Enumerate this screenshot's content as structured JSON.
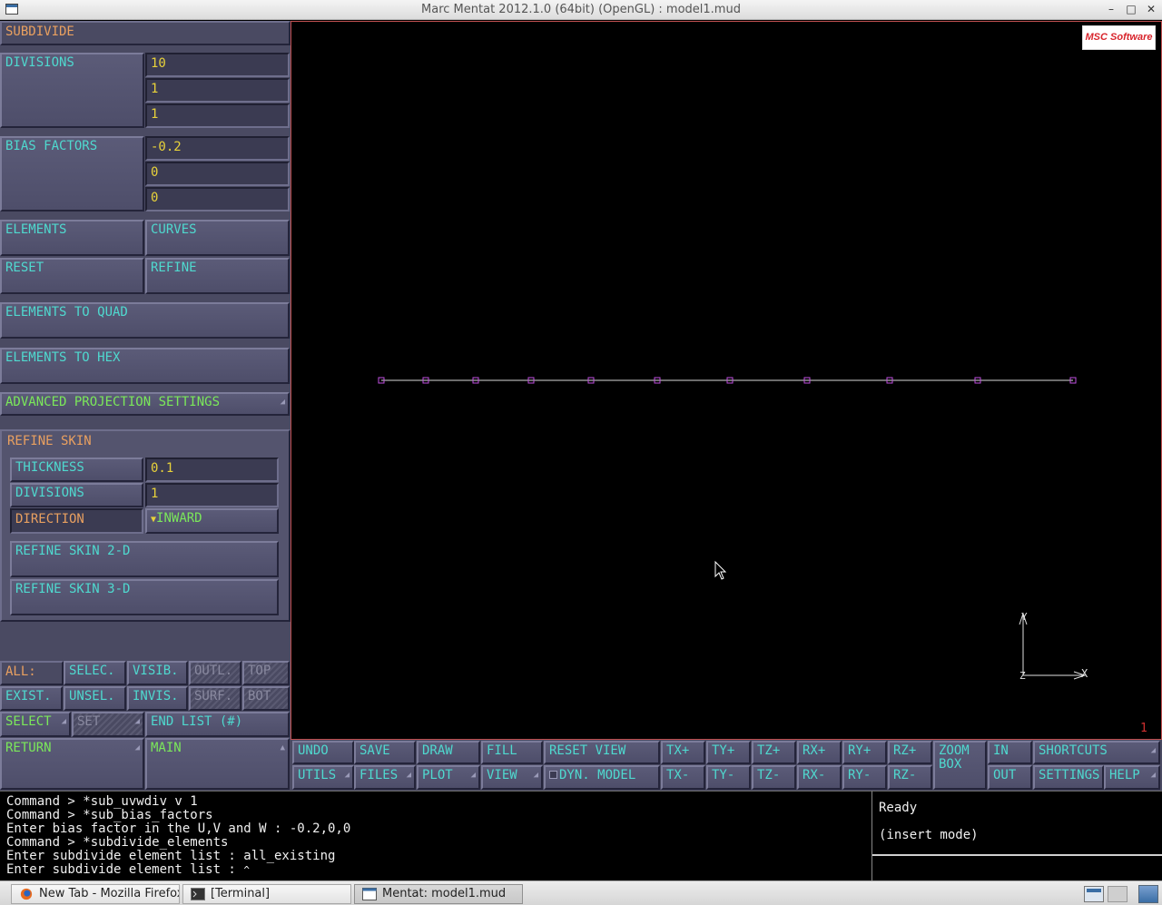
{
  "window": {
    "title": "Marc Mentat 2012.1.0 (64bit) (OpenGL) : model1.mud"
  },
  "panel": {
    "title": "SUBDIVIDE",
    "divisions": {
      "label": "DIVISIONS",
      "values": [
        "10",
        "1",
        "1"
      ]
    },
    "bias": {
      "label": "BIAS FACTORS",
      "values": [
        "-0.2",
        "0",
        "0"
      ]
    },
    "elements": "ELEMENTS",
    "curves": "CURVES",
    "reset": "RESET",
    "refine": "REFINE",
    "to_quad": "ELEMENTS TO QUAD",
    "to_hex": "ELEMENTS TO HEX",
    "adv_proj": "ADVANCED PROJECTION SETTINGS",
    "refine_skin": {
      "title": "REFINE SKIN",
      "thickness_label": "THICKNESS",
      "thickness_value": "0.1",
      "divisions_label": "DIVISIONS",
      "divisions_value": "1",
      "direction_label": "DIRECTION",
      "direction_value": "INWARD",
      "skin2d": "REFINE SKIN 2-D",
      "skin3d": "REFINE SKIN 3-D"
    },
    "select": {
      "all": "ALL:",
      "selec": "SELEC.",
      "visib": "VISIB.",
      "outl": "OUTL.",
      "top": "TOP",
      "exist": "EXIST.",
      "unsel": "UNSEL.",
      "invis": "INVIS.",
      "surf": "SURF.",
      "bot": "BOT",
      "select": "SELECT",
      "set": "SET",
      "end_list": "END LIST (#)",
      "return": "RETURN",
      "main": "MAIN"
    }
  },
  "viewport": {
    "logo_text": "MSC Software",
    "axis_x": "X",
    "axis_y": "Y",
    "axis_z": "Z",
    "viewport_number": "1",
    "mesh_color": "#c050e0",
    "node_count": 11
  },
  "toolbar": {
    "undo": "UNDO",
    "save": "SAVE",
    "draw": "DRAW",
    "fill": "FILL",
    "reset_view": "RESET VIEW",
    "txp": "TX+",
    "typ": "TY+",
    "tzp": "TZ+",
    "rxp": "RX+",
    "ryp": "RY+",
    "rzp": "RZ+",
    "zoom_box": "ZOOM BOX",
    "in": "IN",
    "shortcuts": "SHORTCUTS",
    "utils": "UTILS",
    "files": "FILES",
    "plot": "PLOT",
    "view": "VIEW",
    "dyn_model": "DYN. MODEL",
    "txm": "TX-",
    "tym": "TY-",
    "tzm": "TZ-",
    "rxm": "RX-",
    "rym": "RY-",
    "rzm": "RZ-",
    "out": "OUT",
    "settings": "SETTINGS",
    "help": "HELP"
  },
  "command_log": [
    "Command > *sub_uvwdiv v 1",
    "Command > *sub_bias_factors",
    "Enter bias factor in the U,V and W : -0.2,0,0",
    "Command > *subdivide_elements",
    "Enter subdivide element list : all_existing",
    "Enter subdivide element list :"
  ],
  "status": {
    "line1": "Ready",
    "line2": "(insert mode)"
  },
  "taskbar": {
    "firefox": "New Tab - Mozilla Firefox",
    "terminal": "[Terminal]",
    "mentat": "Mentat: model1.mud"
  }
}
